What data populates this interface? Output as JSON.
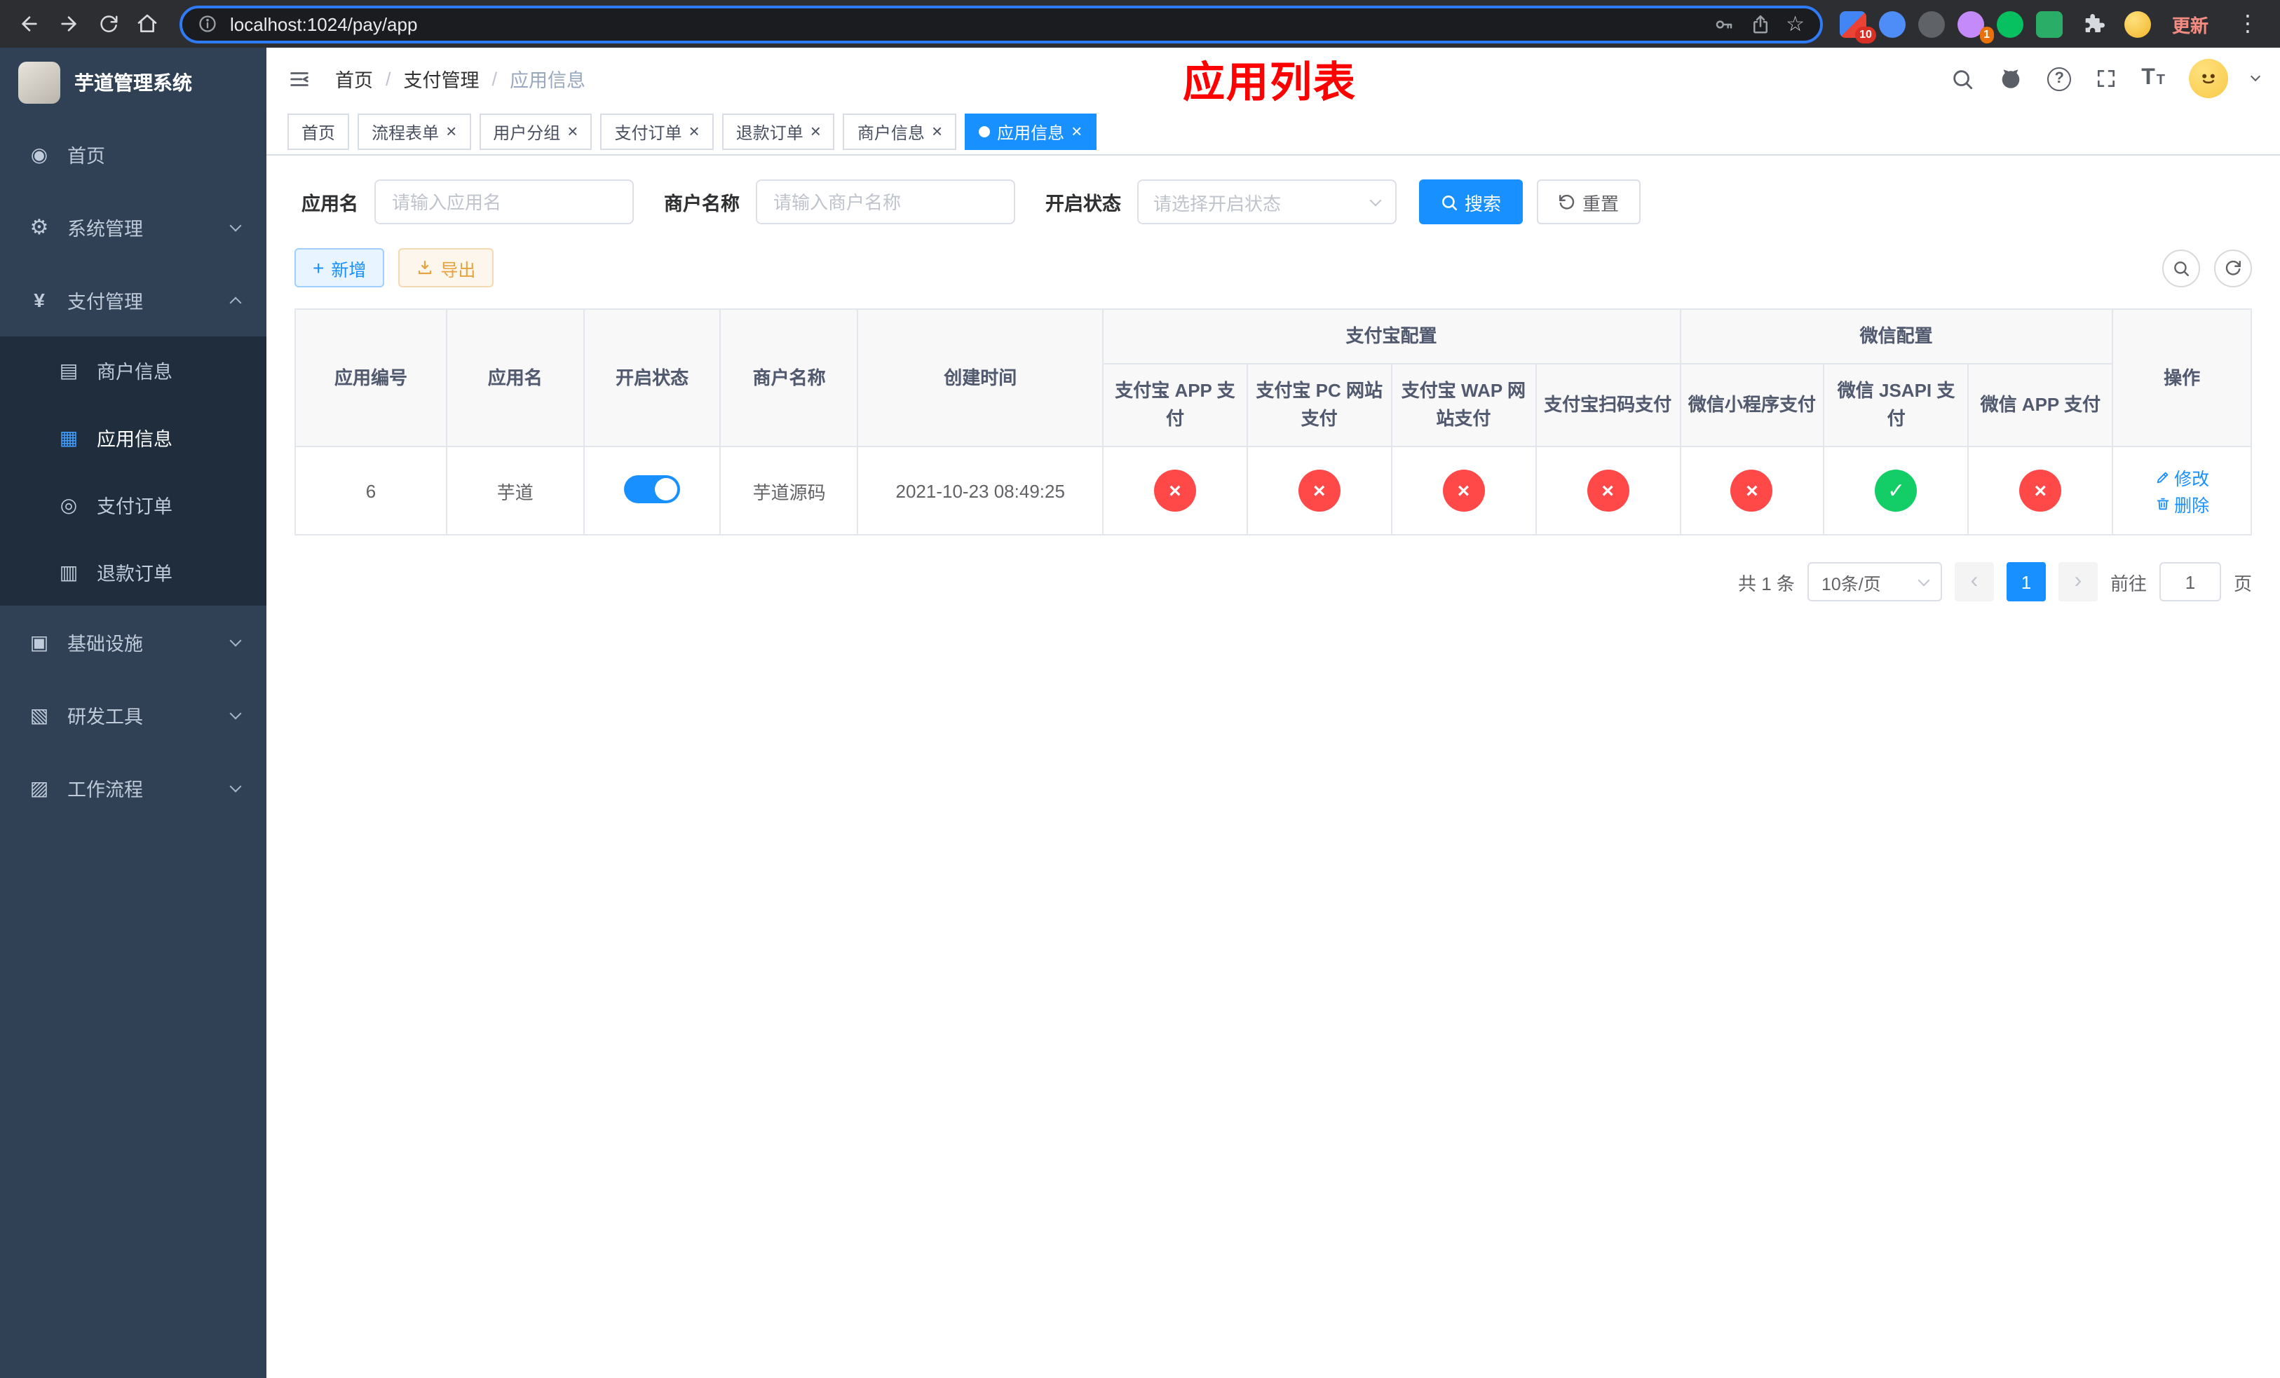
{
  "colors": {
    "primary": "#1890ff",
    "success": "#13ce66",
    "danger": "#ff4949",
    "warning": "#e6a23c",
    "sidebar_bg": "#304156",
    "annotation_red": "#ff0000"
  },
  "browser": {
    "url": "localhost:1024/pay/app",
    "update_label": "更新",
    "badges": {
      "extension1": "10",
      "extension2": "1"
    }
  },
  "sidebar": {
    "title": "芋道管理系统",
    "items": [
      {
        "label": "首页"
      },
      {
        "label": "系统管理"
      },
      {
        "label": "支付管理"
      },
      {
        "label": "商户信息"
      },
      {
        "label": "应用信息"
      },
      {
        "label": "支付订单"
      },
      {
        "label": "退款订单"
      },
      {
        "label": "基础设施"
      },
      {
        "label": "研发工具"
      },
      {
        "label": "工作流程"
      }
    ]
  },
  "header": {
    "breadcrumb": [
      "首页",
      "支付管理",
      "应用信息"
    ],
    "page_title": "应用列表"
  },
  "tabs": [
    {
      "label": "首页"
    },
    {
      "label": "流程表单"
    },
    {
      "label": "用户分组"
    },
    {
      "label": "支付订单"
    },
    {
      "label": "退款订单"
    },
    {
      "label": "商户信息"
    },
    {
      "label": "应用信息"
    }
  ],
  "filters": {
    "app_name_label": "应用名",
    "app_name_placeholder": "请输入应用名",
    "merchant_label": "商户名称",
    "merchant_placeholder": "请输入商户名称",
    "status_label": "开启状态",
    "status_placeholder": "请选择开启状态",
    "search_label": "搜索",
    "reset_label": "重置"
  },
  "toolbar": {
    "add_label": "新增",
    "export_label": "导出"
  },
  "table": {
    "columns": [
      "应用编号",
      "应用名",
      "开启状态",
      "商户名称",
      "创建时间"
    ],
    "groups": [
      {
        "label": "支付宝配置",
        "children": [
          "支付宝 APP 支付",
          "支付宝 PC 网站支付",
          "支付宝 WAP 网站支付",
          "支付宝扫码支付"
        ]
      },
      {
        "label": "微信配置",
        "children": [
          "微信小程序支付",
          "微信 JSAPI 支付",
          "微信 APP 支付"
        ]
      }
    ],
    "action_column": "操作",
    "row": {
      "id": "6",
      "name": "芋道",
      "enabled": true,
      "merchant": "芋道源码",
      "created_at": "2021-10-23 08:49:25",
      "channels": [
        "closed",
        "closed",
        "closed",
        "closed",
        "closed",
        "open",
        "closed"
      ],
      "actions": [
        "修改",
        "删除"
      ]
    }
  },
  "pagination": {
    "total_text": "共 1 条",
    "page_size_text": "10条/页",
    "current_page": "1",
    "goto_label": "前往",
    "goto_value": "1",
    "goto_unit": "页"
  }
}
